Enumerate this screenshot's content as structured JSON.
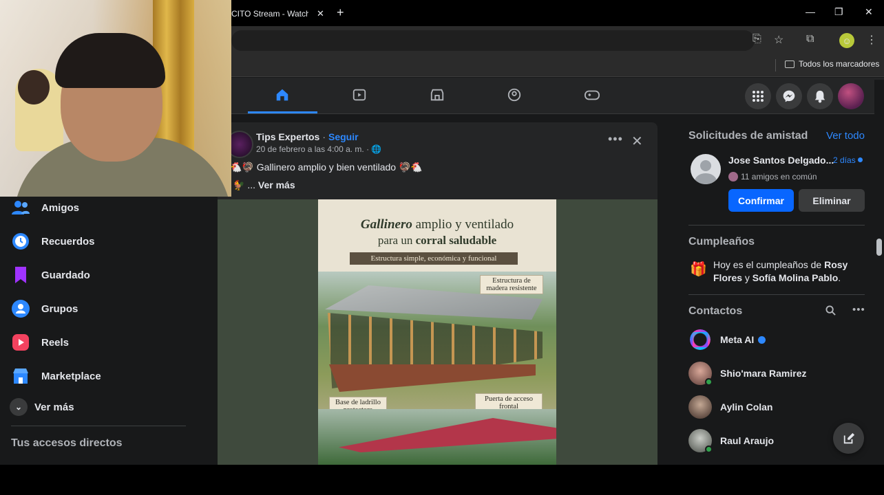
{
  "browser": {
    "tab_title": "CITO Stream - Watch L",
    "tab_close": "✕",
    "new_tab": "+",
    "window_controls": [
      "—",
      "❐",
      "✕"
    ],
    "bookmarks_folder": "Todos los marcadores"
  },
  "fb_nav": {
    "icons": [
      "home-icon",
      "video-icon",
      "marketplace-icon",
      "groups-icon",
      "gaming-icon"
    ],
    "accent_color": "#2d88ff"
  },
  "left_nav": {
    "items": [
      {
        "label": "Amigos",
        "icon": "friends-icon",
        "color": "#2d88ff"
      },
      {
        "label": "Recuerdos",
        "icon": "memories-icon",
        "color": "#2d88ff"
      },
      {
        "label": "Guardado",
        "icon": "saved-icon",
        "color": "#a033ff"
      },
      {
        "label": "Grupos",
        "icon": "groups-icon",
        "color": "#2d88ff"
      },
      {
        "label": "Reels",
        "icon": "reels-icon",
        "color": "#f3425f"
      },
      {
        "label": "Marketplace",
        "icon": "marketplace-icon",
        "color": "#2d88ff"
      }
    ],
    "see_more": "Ver más",
    "shortcuts_title": "Tus accesos directos"
  },
  "post": {
    "author": "Tips Expertos",
    "separator": "·",
    "follow": "Seguir",
    "date": "20 de febrero a las 4:00 a. m. · 🌐",
    "text": "🐔🦃 Gallinero amplio y bien ventilado 🦃🐔",
    "see_more_prefix": "🐓 ... ",
    "see_more": "Ver más",
    "more": "•••",
    "close": "✕",
    "image": {
      "title_italic": "Gallinero",
      "title_rest": " amplio y ventilado",
      "subtitle_pre": "para un ",
      "subtitle_bold": "corral saludable",
      "ribbon": "Estructura simple, económica y funcional",
      "label_structure_1": "Estructura de",
      "label_structure_2": "madera resistente",
      "label_base_1": "Base de ladrillo",
      "label_base_2": "protectora",
      "label_door_1": "Puerta de acceso",
      "label_door_2": "frontal"
    }
  },
  "right": {
    "friend_requests_title": "Solicitudes de amistad",
    "see_all": "Ver todo",
    "request": {
      "name": "Jose Santos Delgado...",
      "time": "2 días",
      "mutual": "11 amigos en común",
      "confirm": "Confirmar",
      "delete": "Eliminar"
    },
    "birthdays_title": "Cumpleaños",
    "birthday_pre": "Hoy es el cumpleaños de ",
    "birthday_names": "Rosy Flores",
    "birthday_mid": " y ",
    "birthday_names2": "Sofía Molina Pablo",
    "birthday_end": ".",
    "contacts_title": "Contactos",
    "contacts": [
      {
        "name": "Meta AI"
      },
      {
        "name": "Shio'mara Ramirez"
      },
      {
        "name": "Aylin Colan"
      },
      {
        "name": "Raul Araujo"
      }
    ]
  }
}
